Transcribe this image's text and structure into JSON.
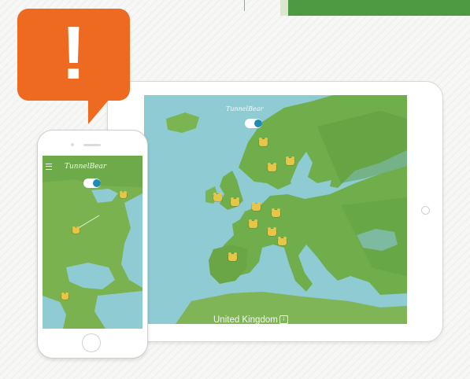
{
  "alert": {
    "icon": "exclamation-icon",
    "symbol": "!",
    "color": "#ef6a21"
  },
  "tablet_app": {
    "logo": "TunnelBear",
    "toggle": {
      "state": "on"
    },
    "selected_country": "United Kingdom",
    "country_info_icon": "info-icon"
  },
  "phone_app": {
    "logo": "TunnelBear",
    "toggle": {
      "state": "on"
    }
  },
  "colors": {
    "ocean": "#8fcbd3",
    "land": "#6fae4a",
    "accent": "#1f8cb4",
    "bear": "#e6c547"
  }
}
